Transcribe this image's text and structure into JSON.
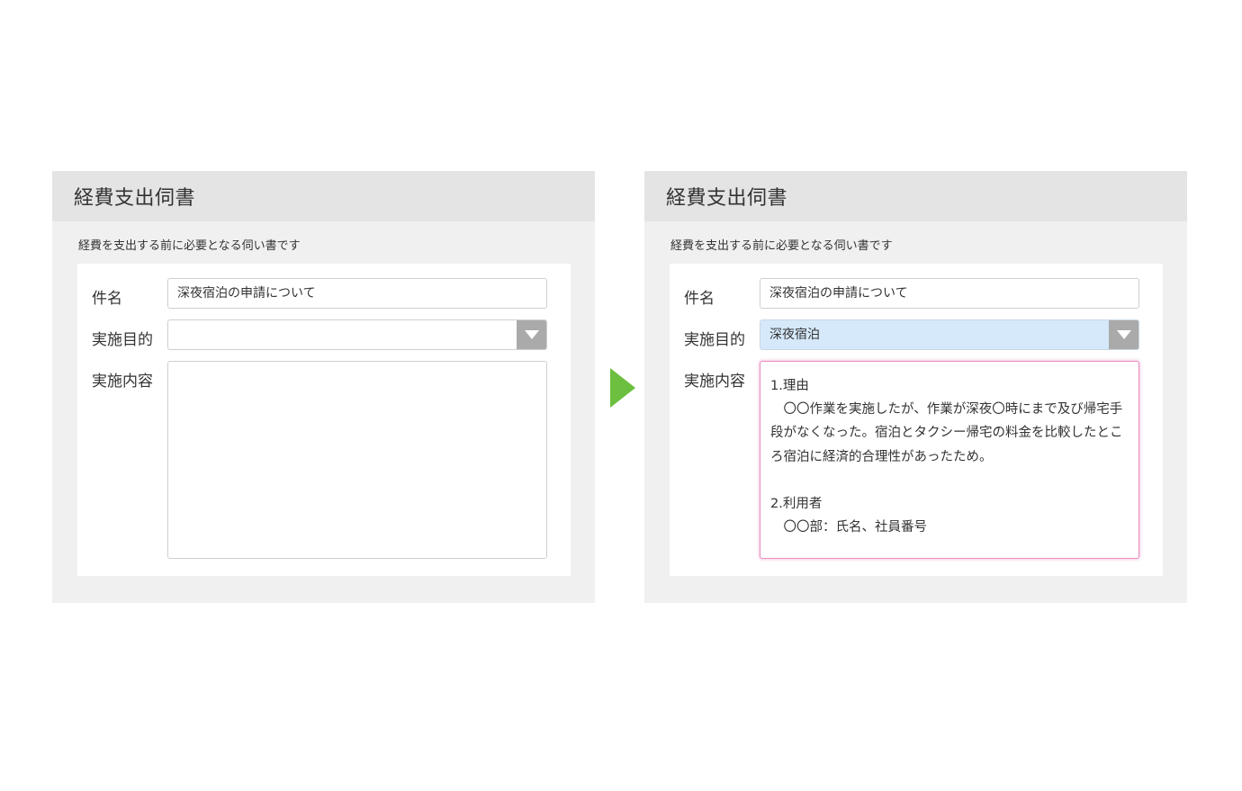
{
  "accent_color": "#6cbf3f",
  "focus_border_color": "#e98ec0",
  "selected_fill_color": "#d6e9fb",
  "before": {
    "title": "経費支出伺書",
    "description": "経費を支出する前に必要となる伺い書です",
    "fields": {
      "subject_label": "件名",
      "subject_value": "深夜宿泊の申請について",
      "purpose_label": "実施目的",
      "purpose_value": "",
      "content_label": "実施内容",
      "content_value": ""
    }
  },
  "transition_icon": "play-arrow-icon",
  "after": {
    "title": "経費支出伺書",
    "description": "経費を支出する前に必要となる伺い書です",
    "fields": {
      "subject_label": "件名",
      "subject_value": "深夜宿泊の申請について",
      "purpose_label": "実施目的",
      "purpose_value": "深夜宿泊",
      "content_label": "実施内容",
      "content_value": "1.理由\n　〇〇作業を実施したが、作業が深夜〇時にまで及び帰宅手段がなくなった。宿泊とタクシー帰宅の料金を比較したところ宿泊に経済的合理性があったため。\n\n2.利用者\n　〇〇部：氏名、社員番号"
    }
  }
}
